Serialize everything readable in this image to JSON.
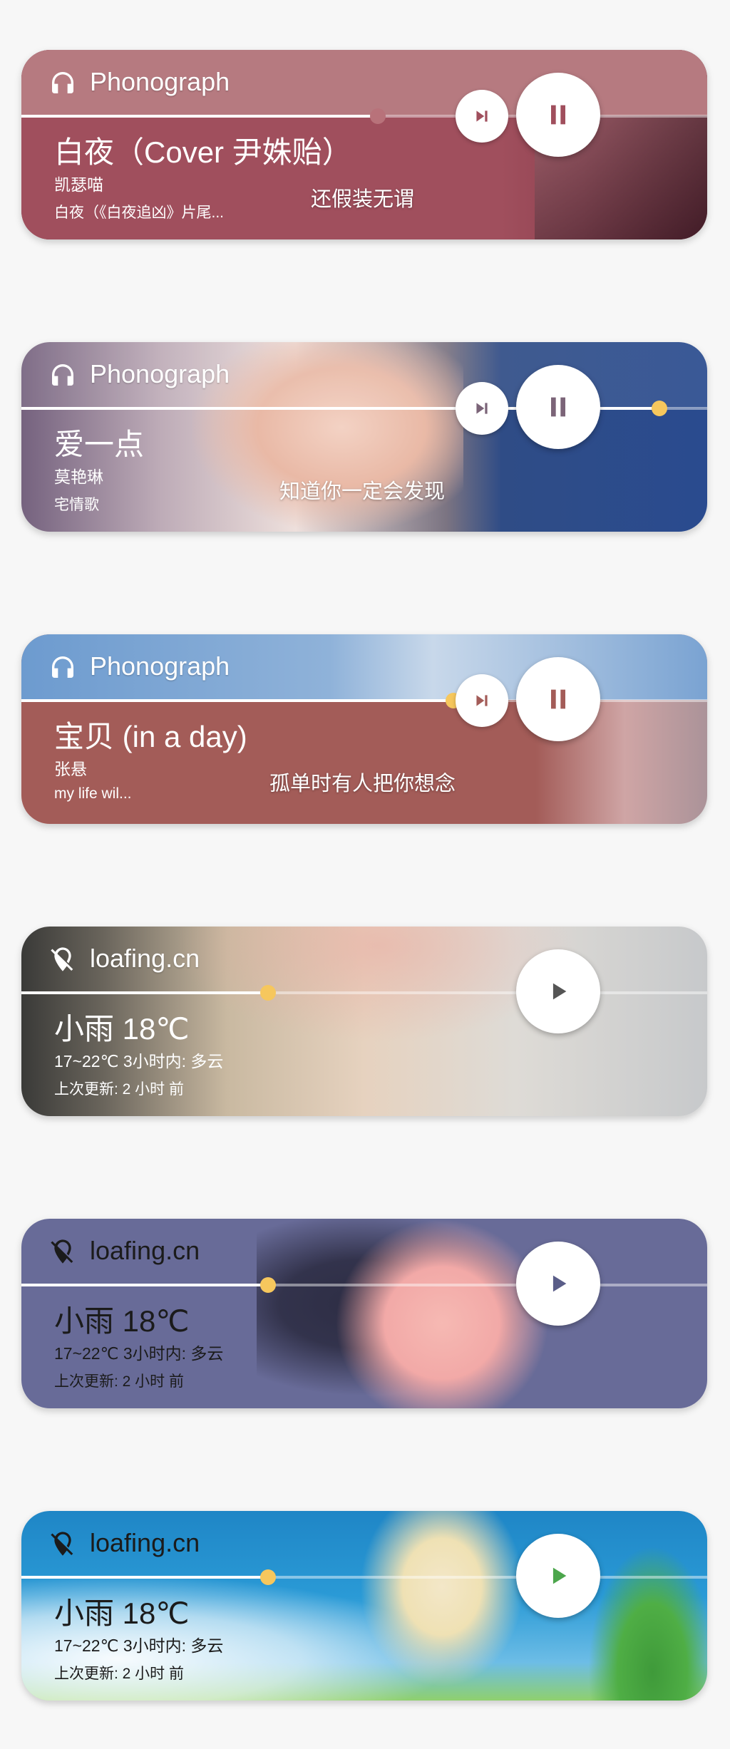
{
  "colors": {
    "thumb": "#f6c75d",
    "track": "#ffffff",
    "weather_play": "#4a4a4a",
    "weather_play_green": "#4ca64c"
  },
  "cards": [
    {
      "kind": "music",
      "brand": {
        "label": "Phonograph",
        "icon": "headphones-icon"
      },
      "title": "白夜（Cover 尹姝贻）",
      "artist": "凯瑟喵",
      "album": "白夜（《白夜追凶》片尾...",
      "lyric": "还假装无谓",
      "progress": 0.52,
      "state": "playing",
      "accent": "#a25260",
      "next_label": "next-track",
      "main_icon": "pause-icon"
    },
    {
      "kind": "music",
      "brand": {
        "label": "Phonograph",
        "icon": "headphones-icon"
      },
      "title": "爱一点",
      "artist": "莫艳琳",
      "album": "宅情歌",
      "lyric": "知道你一定会发现",
      "progress": 0.93,
      "state": "playing",
      "accent": "#6e5a6e",
      "next_label": "next-track",
      "main_icon": "pause-icon"
    },
    {
      "kind": "music",
      "brand": {
        "label": "Phonograph",
        "icon": "headphones-icon"
      },
      "title": "宝贝 (in a day)",
      "artist": "张悬",
      "album": "my life wil...",
      "lyric": "孤单时有人把你想念",
      "progress": 0.63,
      "state": "playing",
      "accent": "#a35c58",
      "next_label": "next-track",
      "main_icon": "pause-icon"
    },
    {
      "kind": "weather",
      "brand": {
        "label": "loafing.cn",
        "icon": "location-off-icon"
      },
      "title": "小雨 18℃",
      "line2": "17~22℃ 3小时内: 多云",
      "line3": "上次更新: 2 小时 前",
      "progress": 0.36,
      "main_icon": "play-icon"
    },
    {
      "kind": "weather",
      "brand": {
        "label": "loafing.cn",
        "icon": "location-off-icon"
      },
      "title": "小雨 18℃",
      "line2": "17~22℃ 3小时内: 多云",
      "line3": "上次更新: 2 小时 前",
      "progress": 0.36,
      "main_icon": "play-icon"
    },
    {
      "kind": "weather",
      "brand": {
        "label": "loafing.cn",
        "icon": "location-off-icon"
      },
      "title": "小雨 18℃",
      "line2": "17~22℃ 3小时内: 多云",
      "line3": "上次更新: 2 小时 前",
      "progress": 0.36,
      "main_icon": "play-icon"
    }
  ]
}
